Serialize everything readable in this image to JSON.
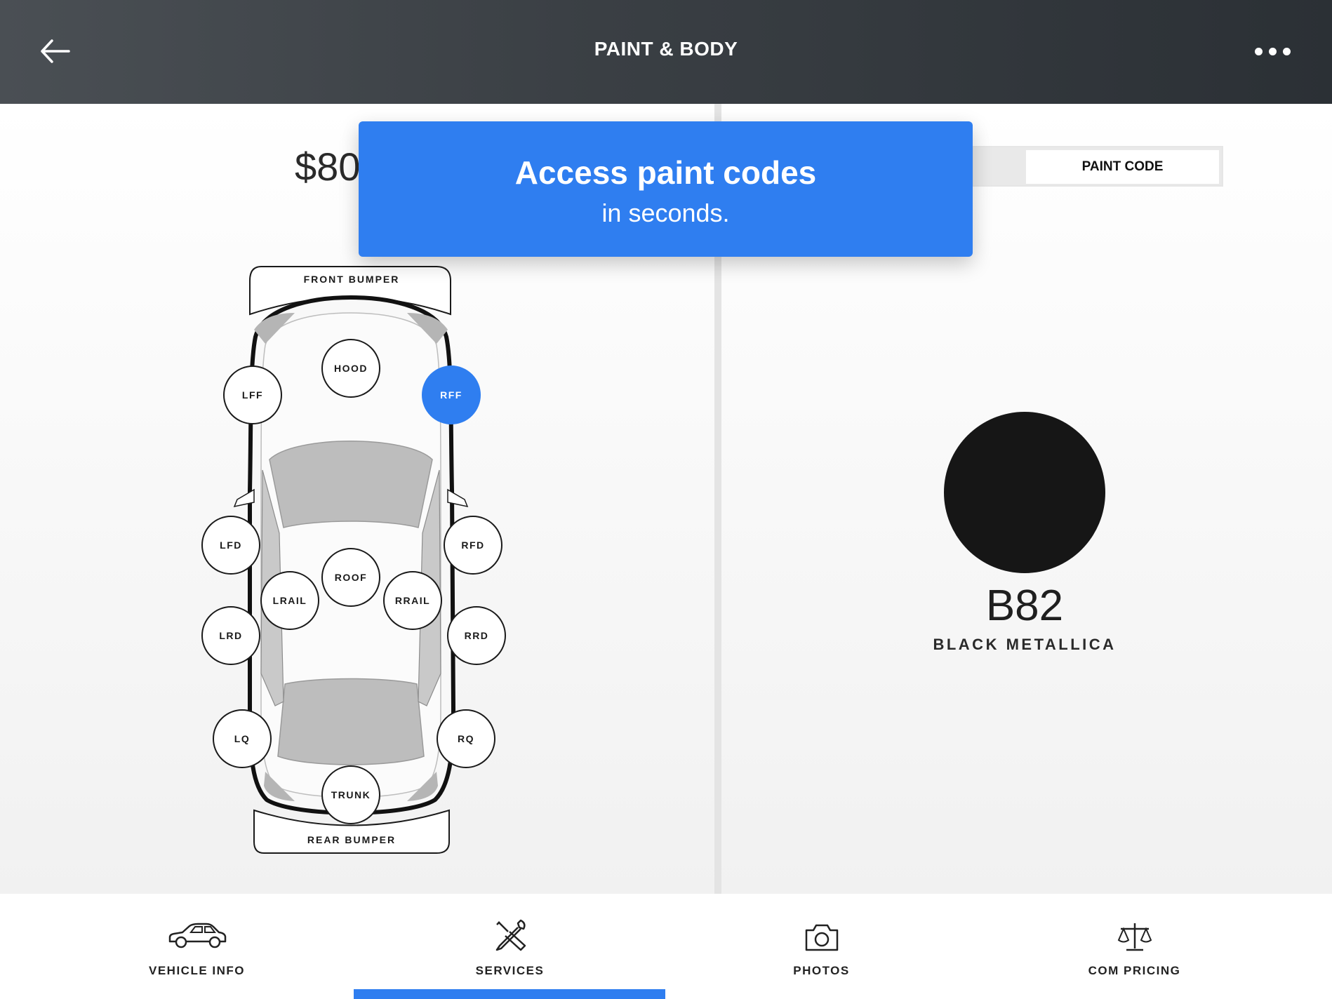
{
  "header": {
    "title": "PAINT & BODY",
    "back_icon": "arrow-left-icon",
    "menu_icon": "more-horizontal-icon"
  },
  "estimate": {
    "price": "$80"
  },
  "banner": {
    "headline": "Access paint codes",
    "subline": "in seconds."
  },
  "toggle": {
    "selected_label": "PAINT CODE"
  },
  "diagram": {
    "front_bumper": "FRONT BUMPER",
    "rear_bumper": "REAR BUMPER",
    "zones": {
      "hood": "HOOD",
      "lff": "LFF",
      "rff": "RFF",
      "lfd": "LFD",
      "rfd": "RFD",
      "roof": "ROOF",
      "lrail": "LRAIL",
      "rrail": "RRAIL",
      "lrd": "LRD",
      "rrd": "RRD",
      "lq": "LQ",
      "rq": "RQ",
      "trunk": "TRUNK"
    },
    "selected_zone": "RFF"
  },
  "paint": {
    "code": "B82",
    "name": "BLACK METALLICA",
    "swatch_color": "#161616"
  },
  "tabs": [
    {
      "label": "VEHICLE INFO",
      "icon": "car-icon"
    },
    {
      "label": "SERVICES",
      "icon": "tools-icon"
    },
    {
      "label": "PHOTOS",
      "icon": "camera-icon"
    },
    {
      "label": "COM PRICING",
      "icon": "scale-icon"
    }
  ],
  "active_tab": "SERVICES",
  "colors": {
    "accent": "#2f7ef0",
    "header_dark": "#2b3035"
  }
}
